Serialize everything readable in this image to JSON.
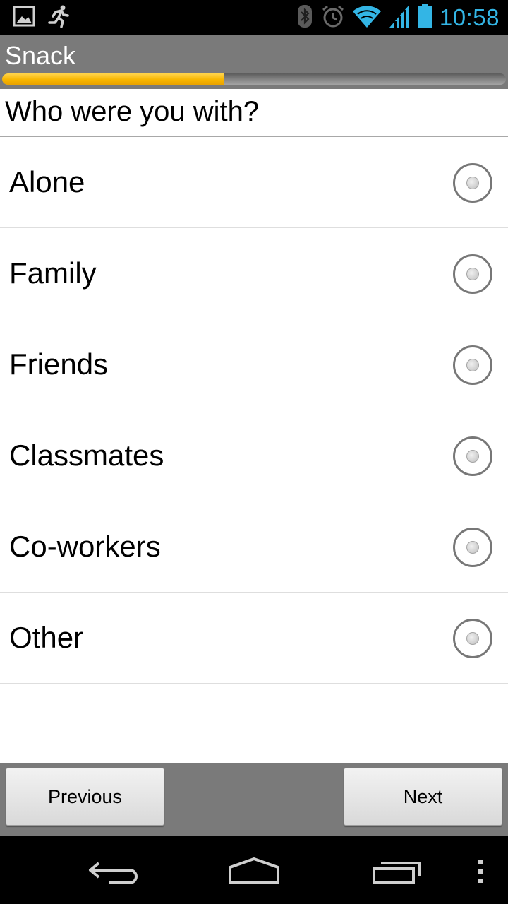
{
  "status_bar": {
    "time": "10:58",
    "icons": [
      "gallery-icon",
      "running-man-icon",
      "bluetooth-icon",
      "alarm-icon",
      "wifi-icon",
      "signal-icon",
      "battery-icon"
    ],
    "accent_color": "#33b5e5"
  },
  "header": {
    "title": "Snack",
    "progress": 0.44,
    "progress_color": "#f7b500",
    "background_color": "#7a7a7a"
  },
  "question": {
    "text": "Who were you with?"
  },
  "options": [
    {
      "label": "Alone",
      "selected": false
    },
    {
      "label": "Family",
      "selected": false
    },
    {
      "label": "Friends",
      "selected": false
    },
    {
      "label": "Classmates",
      "selected": false
    },
    {
      "label": "Co-workers",
      "selected": false
    },
    {
      "label": "Other",
      "selected": false
    }
  ],
  "buttons": {
    "previous": "Previous",
    "next": "Next"
  },
  "nav_bar": {
    "icons": [
      "back-icon",
      "home-icon",
      "recent-apps-icon",
      "menu-icon"
    ]
  }
}
